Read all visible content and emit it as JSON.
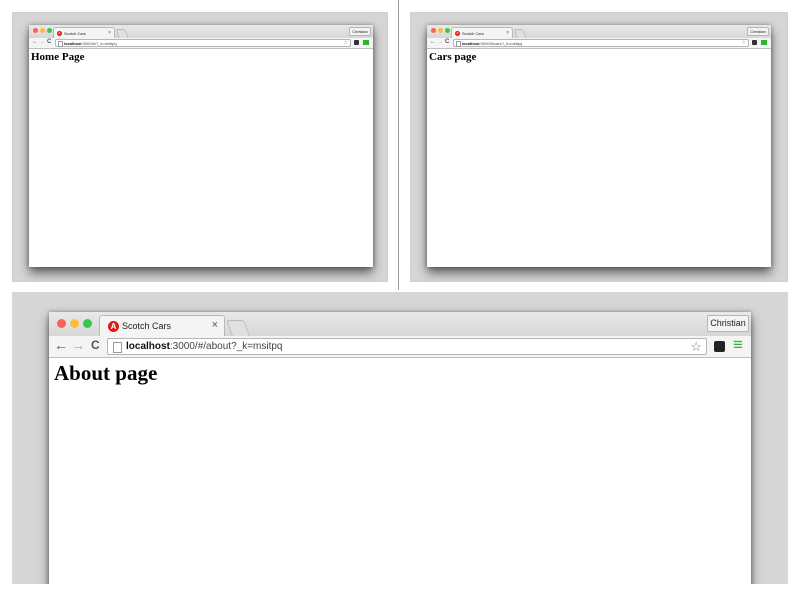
{
  "screenshots": [
    {
      "tab_title": "Scotch Cars",
      "tab_icon": "angular-icon",
      "url_host": "localhost",
      "url_path": ":3000/#/?_k=msitpq",
      "profile": "Christian",
      "heading": "Home Page"
    },
    {
      "tab_title": "Scotch Cars",
      "tab_icon": "angular-icon",
      "url_host": "localhost",
      "url_path": ":3000/#/cars?_k=msitpq",
      "profile": "Christian",
      "heading": "Cars page"
    },
    {
      "tab_title": "Scotch Cars",
      "tab_icon": "angular-icon",
      "url_host": "localhost",
      "url_path": ":3000/#/about?_k=msitpq",
      "profile": "Christian",
      "heading": "About page"
    }
  ],
  "icons": {
    "back": "←",
    "forward": "→",
    "reload": "C",
    "close_tab": "×",
    "star": "☆",
    "angular": "A",
    "menu": "≡"
  },
  "colors": {
    "close_dot": "#fc605b",
    "minimize_dot": "#fdbc40",
    "zoom_dot": "#34c84a",
    "angular_red": "#dd1b16",
    "menu_green": "#2db52d"
  }
}
